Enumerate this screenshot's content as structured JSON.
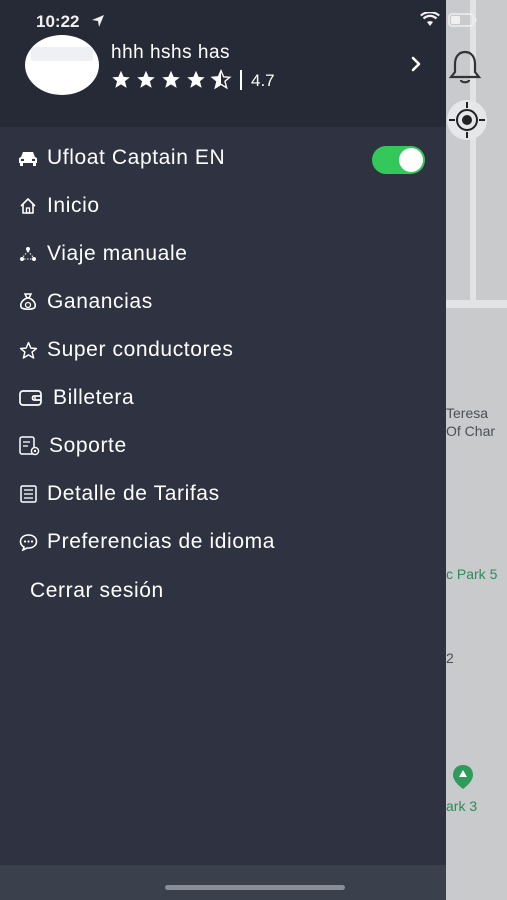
{
  "status_bar": {
    "time": "10:22"
  },
  "profile": {
    "name": "hhh hshs has",
    "rating": "4.7"
  },
  "menu": {
    "items": [
      {
        "label": "Ufloat Captain EN",
        "icon": "car-icon"
      },
      {
        "label": "Inicio",
        "icon": "home-icon"
      },
      {
        "label": "Viaje manuale",
        "icon": "route-icon"
      },
      {
        "label": "Ganancias",
        "icon": "money-bag-icon"
      },
      {
        "label": "Super conductores",
        "icon": "star-outline-icon"
      },
      {
        "label": "Billetera",
        "icon": "wallet-icon"
      },
      {
        "label": "Soporte",
        "icon": "support-icon"
      },
      {
        "label": "Detalle de Tarifas",
        "icon": "list-icon"
      },
      {
        "label": "Preferencias de idioma",
        "icon": "chat-icon"
      }
    ],
    "logout": "Cerrar sesión",
    "captain_mode_enabled": true
  },
  "map": {
    "labels": [
      "Teresa",
      "Of Char",
      "c Park 5",
      "2",
      "ark 3"
    ]
  },
  "colors": {
    "drawer_bg": "#2f3341",
    "header_bg": "#262a36",
    "toggle_on": "#34c759",
    "map_bg": "#cfd1d4"
  }
}
